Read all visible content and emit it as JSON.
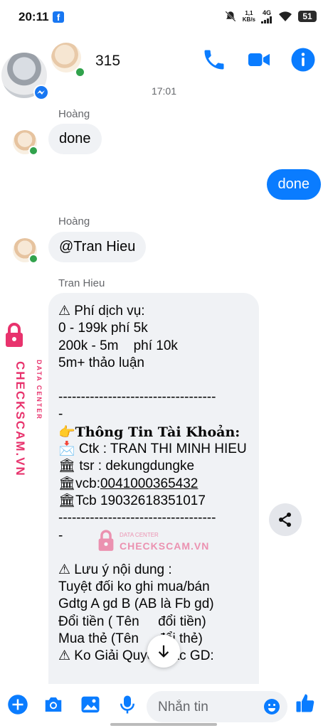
{
  "status_bar": {
    "time": "20:11",
    "facebook_notification": "f",
    "network_speed": "1,1",
    "network_unit": "KB/s",
    "network_type": "4G",
    "battery": "51"
  },
  "header": {
    "title": "315"
  },
  "messages": {
    "timestamp": "17:01",
    "msg1": {
      "sender": "Hoàng",
      "text": "done"
    },
    "msg2": {
      "text": "done"
    },
    "msg3": {
      "sender": "Hoàng",
      "text": "@Tran Hieu"
    },
    "msg4": {
      "sender": "Tran Hieu",
      "lines": [
        "⚠ Phí dịch vụ:",
        "0 - 199k phí 5k",
        "200k - 5m    phí 10k",
        "5m+ thảo luận",
        "",
        "-----------------------------------",
        "-",
        "👉Thông Tin Tài Khoản:",
        "📩 Ctk : TRAN THI MINH HIEU",
        "🏛 tsr : dekungdungke",
        "🏛vcb:0041000365432",
        "🏛Tcb 19032618351017",
        "-----------------------------------",
        "-",
        "",
        "⚠ Lưu ý nội dung :",
        "Tuyệt đối ko ghi mua/bán",
        "Gdtg A gd B (AB là Fb gd)",
        "Đổi tiền ( Tên     đổi tiền)",
        "Mua thẻ (Tên     đổi thẻ)",
        "⚠ Ko Giải Quyết Các GD:"
      ]
    }
  },
  "watermark": {
    "brand": "CHECKSCAM.VN",
    "tagline": "DATA CENTER"
  },
  "composer": {
    "placeholder": "Nhắn tin"
  },
  "colors": {
    "messenger_blue": "#0a7cff",
    "incoming_bubble": "#f0f2f5",
    "online_green": "#31a24c",
    "watermark_pink": "#e8336d"
  }
}
